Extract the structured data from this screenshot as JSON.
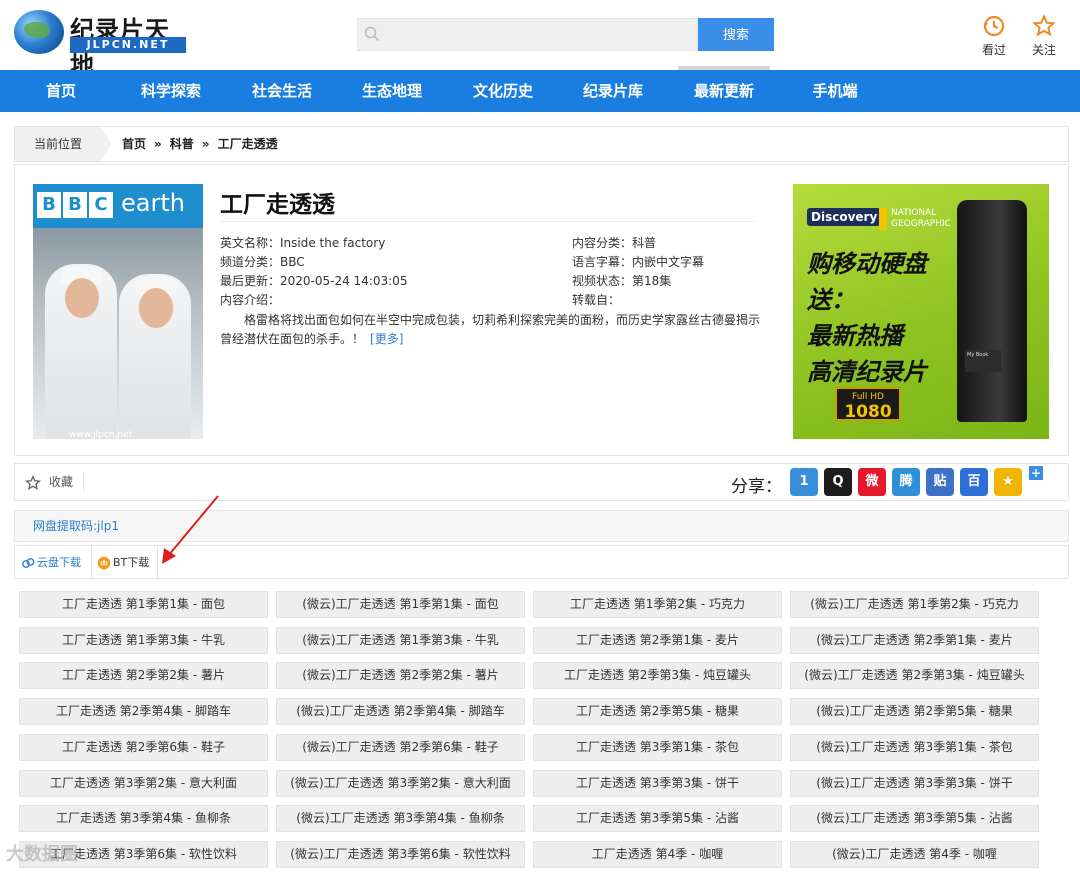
{
  "site": {
    "logo_title": "纪录片天地",
    "logo_sub": "JLPCN.NET",
    "search_button": "搜索",
    "actions": [
      {
        "label": "看过",
        "icon": "history-icon"
      },
      {
        "label": "关注",
        "icon": "star-icon"
      }
    ]
  },
  "nav": {
    "items": [
      {
        "label": "首页"
      },
      {
        "label": "科学探索"
      },
      {
        "label": "社会生活"
      },
      {
        "label": "生态地理"
      },
      {
        "label": "文化历史"
      },
      {
        "label": "纪录片库"
      },
      {
        "label": "最新更新",
        "active": true
      },
      {
        "label": "手机端"
      }
    ]
  },
  "breadcrumb": {
    "label": "当前位置",
    "items": [
      "首页",
      "科普",
      "工厂走透透"
    ],
    "separator": "»"
  },
  "detail": {
    "poster": {
      "brand_letters": [
        "B",
        "B",
        "C"
      ],
      "brand_word": "earth",
      "watermark": "www.jlpcn.net"
    },
    "title": "工厂走透透",
    "left_meta": [
      "英文名称：Inside the factory",
      "频道分类：BBC",
      "最后更新：2020-05-24 14:03:05",
      "内容介绍："
    ],
    "right_meta": [
      "内容分类：科普",
      "语言字幕：内嵌中文字幕",
      "视频状态：第18集",
      "转载自："
    ],
    "intro": "格雷格将找出面包如何在半空中完成包装，切莉希利探索完美的面粉，而历史学家露丝古德曼揭示曾经潜伏在面包的杀手。！",
    "more_label": "[更多]"
  },
  "ad": {
    "logo1": "Discovery",
    "logo2_line1": "NATIONAL",
    "logo2_line2": "GEOGRAPHIC",
    "lines": [
      "购移动硬盘",
      "送：",
      "最新热播",
      "高清纪录片"
    ],
    "hd_top": "Full HD",
    "hd_main": "1080",
    "drive_label": "My Book"
  },
  "share": {
    "favorite_label": "收藏",
    "label": "分享：",
    "icons": [
      {
        "name": "share-1-icon",
        "glyph": "1",
        "color": "#3a8fd8"
      },
      {
        "name": "qq-icon",
        "glyph": "Q",
        "color": "#1c1c1c"
      },
      {
        "name": "weibo-icon",
        "glyph": "微",
        "color": "#e6162d"
      },
      {
        "name": "tencent-weibo-icon",
        "glyph": "腾",
        "color": "#2e8fd6"
      },
      {
        "name": "tieba-icon",
        "glyph": "贴",
        "color": "#3b72c8"
      },
      {
        "name": "baidu-icon",
        "glyph": "百",
        "color": "#2d6fd6"
      },
      {
        "name": "qzone-icon",
        "glyph": "★",
        "color": "#f3b400"
      }
    ],
    "plus": "+"
  },
  "netdisk_code": "网盘提取码:jlp1",
  "tabs": [
    {
      "label": "云盘下载",
      "active": true
    },
    {
      "label": "BT下载",
      "active": false
    }
  ],
  "episodes": [
    "工厂走透透 第1季第1集 - 面包",
    "(微云)工厂走透透 第1季第1集 - 面包",
    "工厂走透透 第1季第2集 - 巧克力",
    "(微云)工厂走透透 第1季第2集 - 巧克力",
    "工厂走透透 第1季第3集 - 牛乳",
    "(微云)工厂走透透 第1季第3集 - 牛乳",
    "工厂走透透 第2季第1集 - 麦片",
    "(微云)工厂走透透 第2季第1集 - 麦片",
    "工厂走透透 第2季第2集 - 薯片",
    "(微云)工厂走透透 第2季第2集 - 薯片",
    "工厂走透透 第2季第3集 - 炖豆罐头",
    "(微云)工厂走透透 第2季第3集 - 炖豆罐头",
    "工厂走透透 第2季第4集 - 脚踏车",
    "(微云)工厂走透透 第2季第4集 - 脚踏车",
    "工厂走透透 第2季第5集 - 糖果",
    "(微云)工厂走透透 第2季第5集 - 糖果",
    "工厂走透透 第2季第6集 - 鞋子",
    "(微云)工厂走透透 第2季第6集 - 鞋子",
    "工厂走透透 第3季第1集 - 茶包",
    "(微云)工厂走透透 第3季第1集 - 茶包",
    "工厂走透透 第3季第2集 - 意大利面",
    "(微云)工厂走透透 第3季第2集 - 意大利面",
    "工厂走透透 第3季第3集 - 饼干",
    "(微云)工厂走透透 第3季第3集 - 饼干",
    "工厂走透透 第3季第4集 - 鱼柳条",
    "(微云)工厂走透透 第3季第4集 - 鱼柳条",
    "工厂走透透 第3季第5集 - 沾酱",
    "(微云)工厂走透透 第3季第5集 - 沾酱",
    "工厂走透透 第3季第6集 - 软性饮料",
    "(微云)工厂走透透 第3季第6集 - 软性饮料",
    "工厂走透透 第4季 - 咖喱",
    "(微云)工厂走透透 第4季 - 咖喱"
  ],
  "page_watermark": "大数据圈"
}
